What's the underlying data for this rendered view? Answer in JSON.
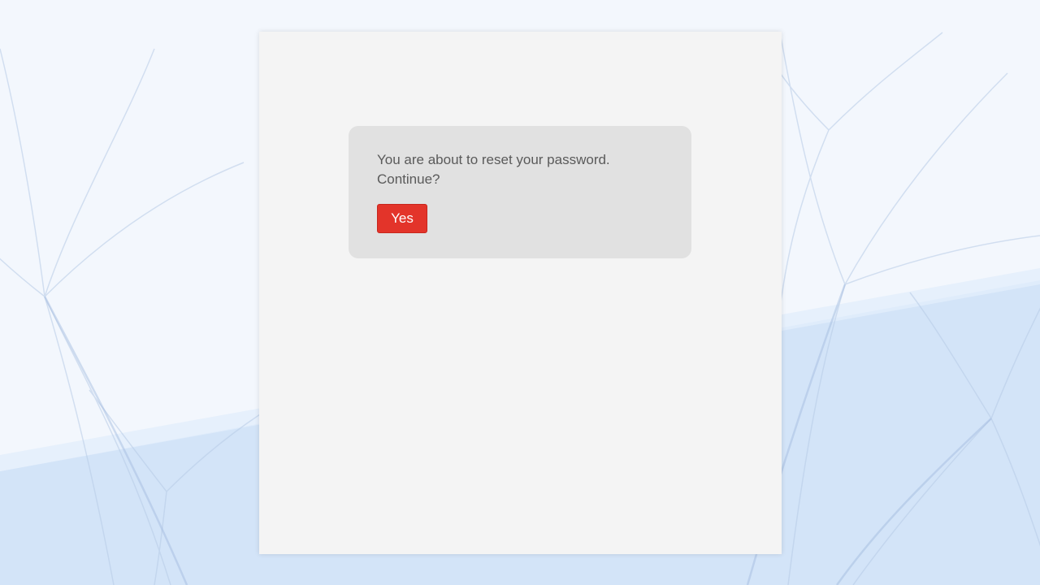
{
  "dialog": {
    "message": "You are about to reset your password. Continue?",
    "confirm_label": "Yes"
  },
  "colors": {
    "background_light": "#f3f7fd",
    "background_blue": "#d3e4f8",
    "panel": "#f4f4f4",
    "dialog": "#e1e1e1",
    "button": "#e3342a",
    "text": "#5a5a5a"
  }
}
